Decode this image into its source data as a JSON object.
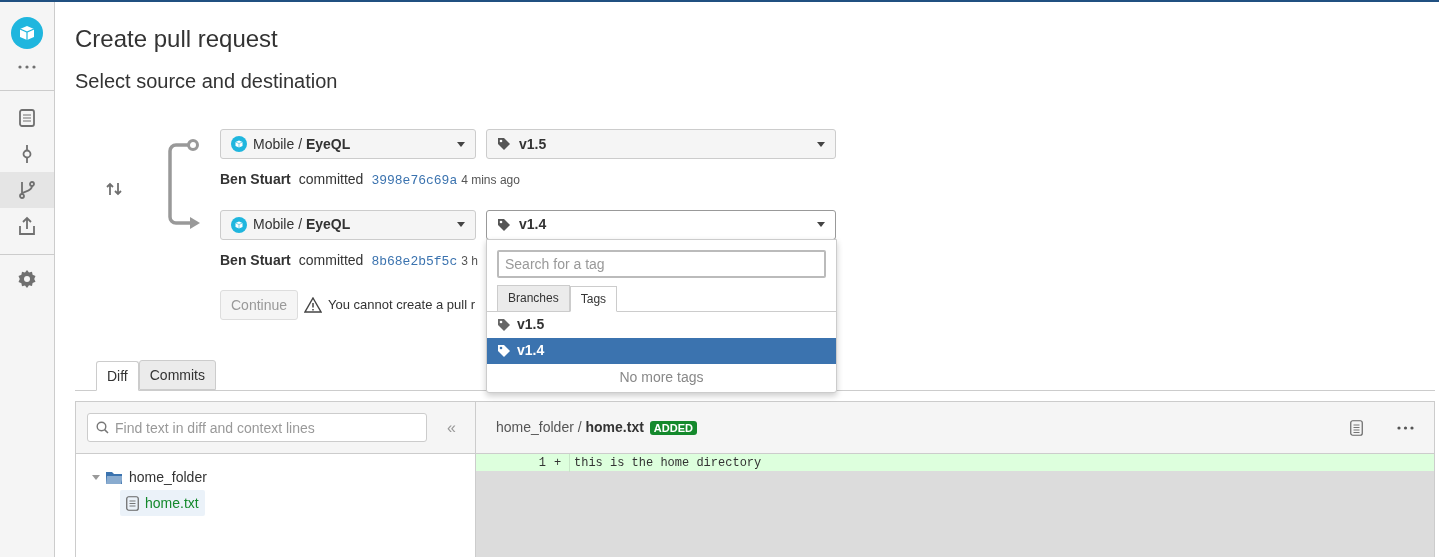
{
  "sidebar": {
    "items": [
      {
        "kind": "doc",
        "selected": false
      },
      {
        "kind": "commit",
        "selected": false
      },
      {
        "kind": "branch",
        "selected": true
      },
      {
        "kind": "upload",
        "selected": false
      }
    ]
  },
  "title": "Create pull request",
  "subtitle": "Select source and destination",
  "source": {
    "project": "Mobile",
    "separator": "/",
    "repo": "EyeQL",
    "tag": "v1.5",
    "author": "Ben Stuart",
    "verb": "committed",
    "hash": "3998e76c69a",
    "time": "4 mins ago"
  },
  "destination": {
    "project": "Mobile",
    "separator": "/",
    "repo": "EyeQL",
    "tag": "v1.4",
    "author": "Ben Stuart",
    "verb": "committed",
    "hash": "8b68e2b5f5c",
    "time": "3 h"
  },
  "continue_button": {
    "label": "Continue",
    "disabled": true
  },
  "warning": "You cannot create a pull r",
  "tag_dropdown": {
    "placeholder": "Search for a tag",
    "tabs": [
      {
        "label": "Branches",
        "selected": false
      },
      {
        "label": "Tags",
        "selected": true
      }
    ],
    "items": [
      {
        "label": "v1.5",
        "selected": false
      },
      {
        "label": "v1.4",
        "selected": true
      }
    ],
    "footer": "No more tags"
  },
  "view_tabs": [
    {
      "label": "Diff",
      "selected": true
    },
    {
      "label": "Commits",
      "selected": false
    }
  ],
  "diff": {
    "search_placeholder": "Find text in diff and context lines",
    "collapse": "«",
    "tree": [
      {
        "name": "home_folder",
        "kind": "folder",
        "expanded": true,
        "children": [
          {
            "name": "home.txt",
            "kind": "file",
            "selected": true
          }
        ]
      }
    ],
    "file": {
      "folder": "home_folder",
      "separator": "/",
      "name": "home.txt",
      "badge": "ADDED"
    },
    "lines": [
      {
        "number": "1",
        "sign": "+",
        "text": "this is the home directory"
      }
    ]
  }
}
